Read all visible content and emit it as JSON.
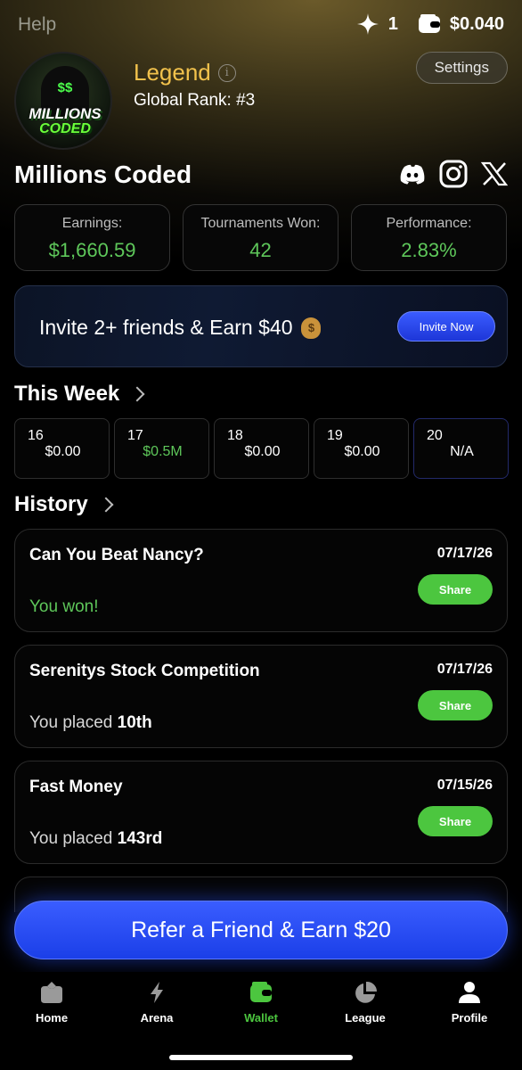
{
  "header": {
    "help_label": "Help",
    "gems": "1",
    "balance": "$0.040"
  },
  "profile": {
    "avatar_text_top": "MILLIONS",
    "avatar_text_bottom": "CODED",
    "avatar_symbol": "$$",
    "tier": "Legend",
    "global_rank": "Global Rank: #3",
    "settings_label": "Settings",
    "name": "Millions Coded"
  },
  "socials": [
    "discord-icon",
    "instagram-icon",
    "x-icon"
  ],
  "stats": [
    {
      "label": "Earnings:",
      "value": "$1,660.59"
    },
    {
      "label": "Tournaments Won:",
      "value": "42"
    },
    {
      "label": "Performance:",
      "value": "2.83%"
    }
  ],
  "invite": {
    "text": "Invite 2+ friends & Earn $40",
    "button": "Invite Now"
  },
  "this_week": {
    "title": "This Week",
    "days": [
      {
        "num": "16",
        "amount": "$0.00"
      },
      {
        "num": "17",
        "amount": "$0.5M"
      },
      {
        "num": "18",
        "amount": "$0.00"
      },
      {
        "num": "19",
        "amount": "$0.00"
      },
      {
        "num": "20",
        "amount": "N/A"
      }
    ]
  },
  "history": {
    "title": "History",
    "items": [
      {
        "title": "Can You Beat Nancy?",
        "date": "07/17/26",
        "share": "Share",
        "result": "You won!"
      },
      {
        "title": "Serenitys Stock Competition",
        "date": "07/17/26",
        "share": "Share",
        "result_prefix": "You placed",
        "placement": "10th"
      },
      {
        "title": "Fast Money",
        "date": "07/15/26",
        "share": "Share",
        "result_prefix": "You placed",
        "placement": "143rd"
      }
    ]
  },
  "refer": {
    "label": "Refer a Friend & Earn $20"
  },
  "tabs": [
    {
      "label": "Home",
      "icon": "home-icon"
    },
    {
      "label": "Arena",
      "icon": "lightning-icon"
    },
    {
      "label": "Wallet",
      "icon": "wallet-icon",
      "active": true
    },
    {
      "label": "League",
      "icon": "pie-chart-icon"
    },
    {
      "label": "Profile",
      "icon": "person-icon"
    }
  ],
  "colors": {
    "accent_green": "#5ec75a",
    "gold": "#f2c24c",
    "blue": "#2446f0"
  }
}
